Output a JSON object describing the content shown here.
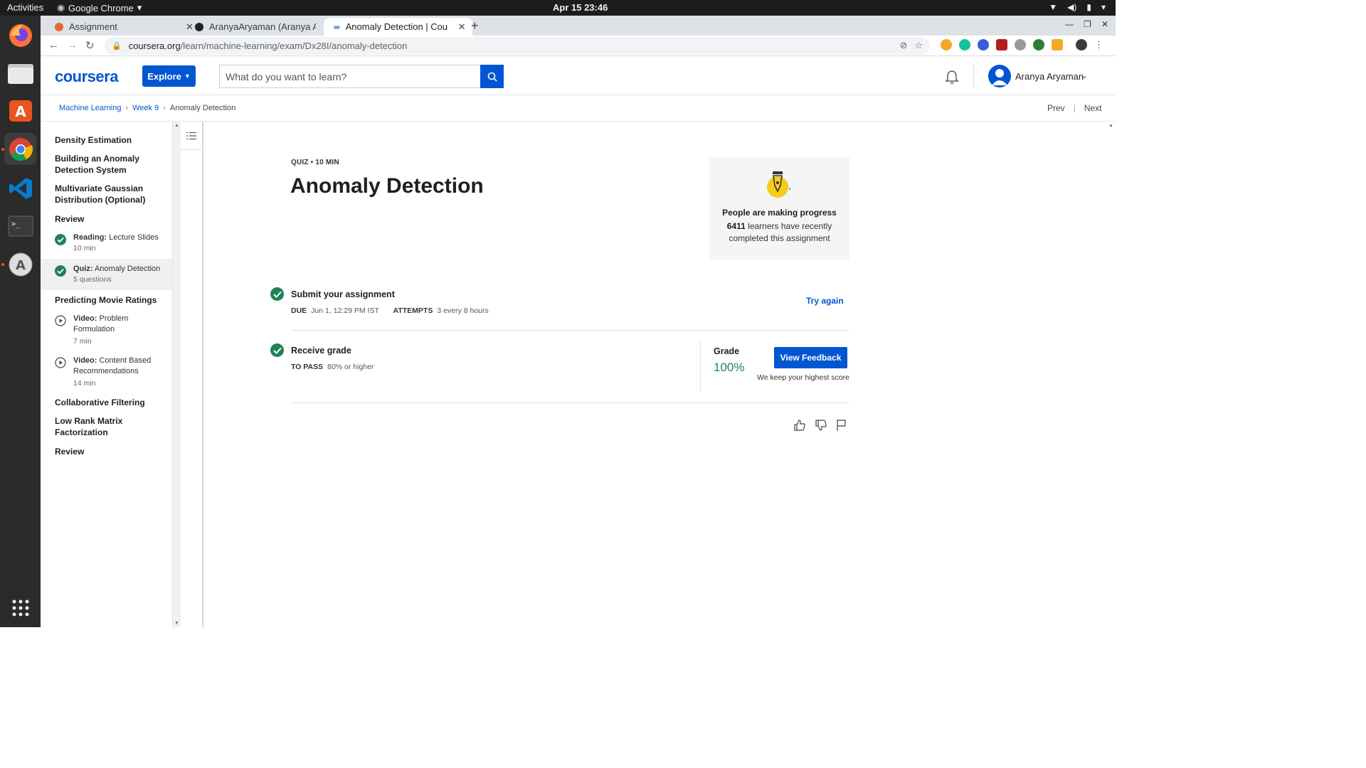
{
  "os": {
    "activities": "Activities",
    "app_name": "Google Chrome",
    "clock": "Apr 15  23:46"
  },
  "browser": {
    "tabs": [
      {
        "title": "Assignment"
      },
      {
        "title": "AranyaAryaman (Aranya A"
      },
      {
        "title": "Anomaly Detection | Cour"
      }
    ],
    "url_host": "coursera.org",
    "url_path": "/learn/machine-learning/exam/Dx28I/anomaly-detection"
  },
  "header": {
    "logo": "coursera",
    "explore_label": "Explore",
    "search_placeholder": "What do you want to learn?",
    "user_name": "Aranya Aryaman"
  },
  "breadcrumb": {
    "course": "Machine Learning",
    "week": "Week 9",
    "current": "Anomaly Detection"
  },
  "pager": {
    "prev": "Prev",
    "next": "Next"
  },
  "sidebar": {
    "h1": "Density Estimation",
    "h2": "Building an Anomaly Detection System",
    "h3": "Multivariate Gaussian Distribution (Optional)",
    "h4": "Review",
    "item1": {
      "kind": "Reading:",
      "name": "Lecture Slides",
      "meta": "10 min"
    },
    "item2": {
      "kind": "Quiz:",
      "name": "Anomaly Detection",
      "meta": "5 questions"
    },
    "h5": "Predicting Movie Ratings",
    "item3": {
      "kind": "Video:",
      "name": "Problem Formulation",
      "meta": "7 min"
    },
    "item4": {
      "kind": "Video:",
      "name": "Content Based Recommendations",
      "meta": "14 min"
    },
    "h6": "Collaborative Filtering",
    "h7": "Low Rank Matrix Factorization",
    "h8": "Review"
  },
  "quiz": {
    "meta": "QUIZ • 10 MIN",
    "title": "Anomaly Detection"
  },
  "progress_card": {
    "title": "People are making progress",
    "count": "6411",
    "line1_rest": "learners have recently",
    "line2": "completed this assignment"
  },
  "submit": {
    "title": "Submit your assignment",
    "due_label": "DUE",
    "due_value": "Jun 1, 12:29 PM IST",
    "attempts_label": "ATTEMPTS",
    "attempts_value": "3 every 8 hours",
    "try_again": "Try again"
  },
  "receive": {
    "title": "Receive grade",
    "pass_label": "TO PASS",
    "pass_value": "80% or higher",
    "grade_label": "Grade",
    "grade_value": "100%",
    "view_feedback": "View Feedback",
    "keep_note": "We keep your highest score"
  },
  "colors": {
    "brand_blue": "#0056d2",
    "success_green": "#1f8354"
  }
}
